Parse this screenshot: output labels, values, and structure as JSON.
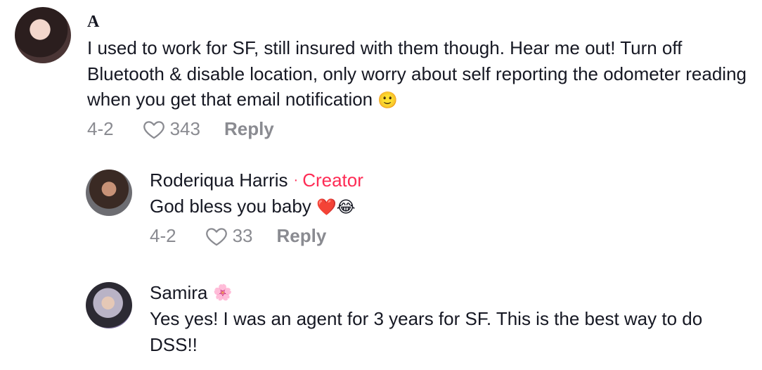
{
  "comments": [
    {
      "username": "A",
      "avatar_icon": "user-avatar",
      "text": "I used to work for SF, still insured with them though. Hear me out! Turn off Bluetooth & disable location, only worry about self reporting the odometer reading when you get that email notification",
      "emoji": "🙂",
      "date": "4-2",
      "likes": "343",
      "reply_label": "Reply"
    },
    {
      "username": "Roderiqua Harris",
      "separator": "·",
      "badge": "Creator",
      "badge_color": "#fe2c55",
      "avatar_icon": "user-avatar",
      "text": "God bless you baby",
      "emoji": "❤️😂",
      "date": "4-2",
      "likes": "33",
      "reply_label": "Reply"
    },
    {
      "username": "Samira",
      "name_emoji": "🌸",
      "avatar_icon": "user-avatar",
      "text": "Yes yes! I was an agent for 3 years for SF. This is the best way to do DSS!!"
    }
  ],
  "icons": {
    "like": "heart-outline-icon"
  },
  "colors": {
    "text": "#161823",
    "meta": "#8a8b91",
    "accent": "#fe2c55"
  }
}
